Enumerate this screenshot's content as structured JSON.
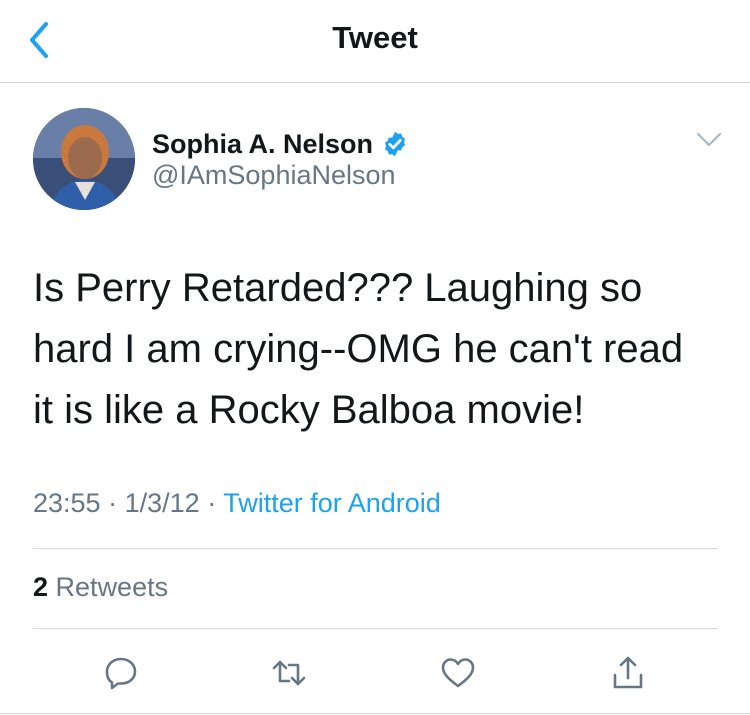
{
  "header": {
    "title": "Tweet"
  },
  "author": {
    "name": "Sophia A. Nelson",
    "handle": "@IAmSophiaNelson"
  },
  "tweet": {
    "lines": [
      "Is Perry Retarded??? Laughing so",
      "hard I am crying--OMG he can't read",
      "it is like a Rocky Balboa movie!"
    ],
    "time": "23:55",
    "separator": "·",
    "date": "1/3/12",
    "source": "Twitter for Android"
  },
  "stats": {
    "retweet_count": "2",
    "retweet_label": "Retweets"
  },
  "icons": {
    "back": "chevron-left-icon",
    "verified": "verified-badge-icon",
    "more": "chevron-down-icon",
    "reply": "reply-icon",
    "retweet": "retweet-icon",
    "like": "heart-icon",
    "share": "share-icon"
  },
  "colors": {
    "accent": "#1da1f2",
    "secondary_text": "#657786",
    "primary_text": "#14171a",
    "icon": "#657786"
  }
}
